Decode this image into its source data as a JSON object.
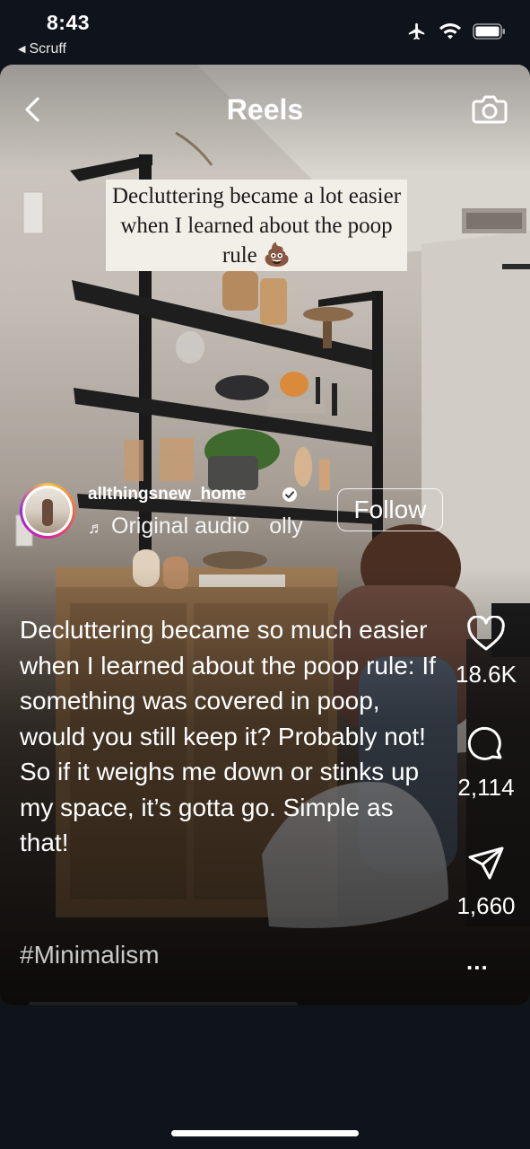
{
  "status_bar": {
    "time": "8:43",
    "back_app": "Scruff"
  },
  "header": {
    "title": "Reels"
  },
  "reel": {
    "overlay_text": "Decluttering became a lot easier when I learned about the poop rule 💩",
    "author": {
      "username": "allthingsnew_home",
      "verified": true
    },
    "audio": {
      "note_icon": "music-note-icon",
      "part1": "Original audio",
      "part2": "olly"
    },
    "follow_label": "Follow",
    "caption": "Decluttering became so much easier when I learned about the poop rule: If something was covered in poop, would you still keep it? Probably not! So if it weighs me down or stinks up my space, it’s gotta go. Simple as that!",
    "hashtag": "#Minimalism",
    "actions": {
      "likes": "18.6K",
      "comments": "2,114",
      "shares": "1,660",
      "more": "..."
    }
  }
}
